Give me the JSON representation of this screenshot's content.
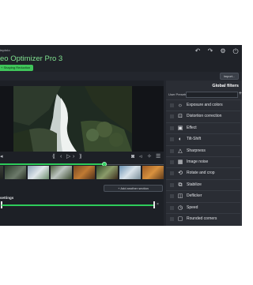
{
  "app": {
    "brand_small": "inpixio",
    "title": "eo Optimizer Pro 3",
    "mode_badge": "+ Shaping Reduction",
    "window_controls": [
      "undo-icon",
      "redo-icon",
      "gear-icon",
      "close-icon"
    ]
  },
  "toolbar": {
    "import_label": "Import..."
  },
  "player": {
    "progress": 0.64,
    "controls": [
      "volume-icon",
      "prev-frame-icon",
      "play-icon",
      "next-frame-icon",
      "snapshot-icon",
      "speaker-icon",
      "magic-icon",
      "menu-icon"
    ]
  },
  "timeline": {
    "add_section_label": "+ Add another section",
    "settings_label": "settings",
    "close_glyph": "×"
  },
  "filters_panel": {
    "title": "Global filters",
    "user_presets_label": "User Presets",
    "add_glyph": "+",
    "items": [
      {
        "label": "Exposure and colors",
        "icon": "sun-icon"
      },
      {
        "label": "Distortion correction",
        "icon": "distortion-icon"
      },
      {
        "label": "Effect",
        "icon": "effect-icon"
      },
      {
        "label": "Tilt-Shift",
        "icon": "tilt-shift-icon"
      },
      {
        "label": "Sharpness",
        "icon": "sharpness-icon"
      },
      {
        "label": "Image noise",
        "icon": "noise-icon"
      },
      {
        "label": "Rotate and crop",
        "icon": "crop-icon"
      },
      {
        "label": "Stabilize",
        "icon": "stabilize-icon"
      },
      {
        "label": "Deflicker",
        "icon": "deflicker-icon"
      },
      {
        "label": "Speed",
        "icon": "speed-icon"
      },
      {
        "label": "Rounded corners",
        "icon": "rounded-corners-icon"
      }
    ]
  }
}
